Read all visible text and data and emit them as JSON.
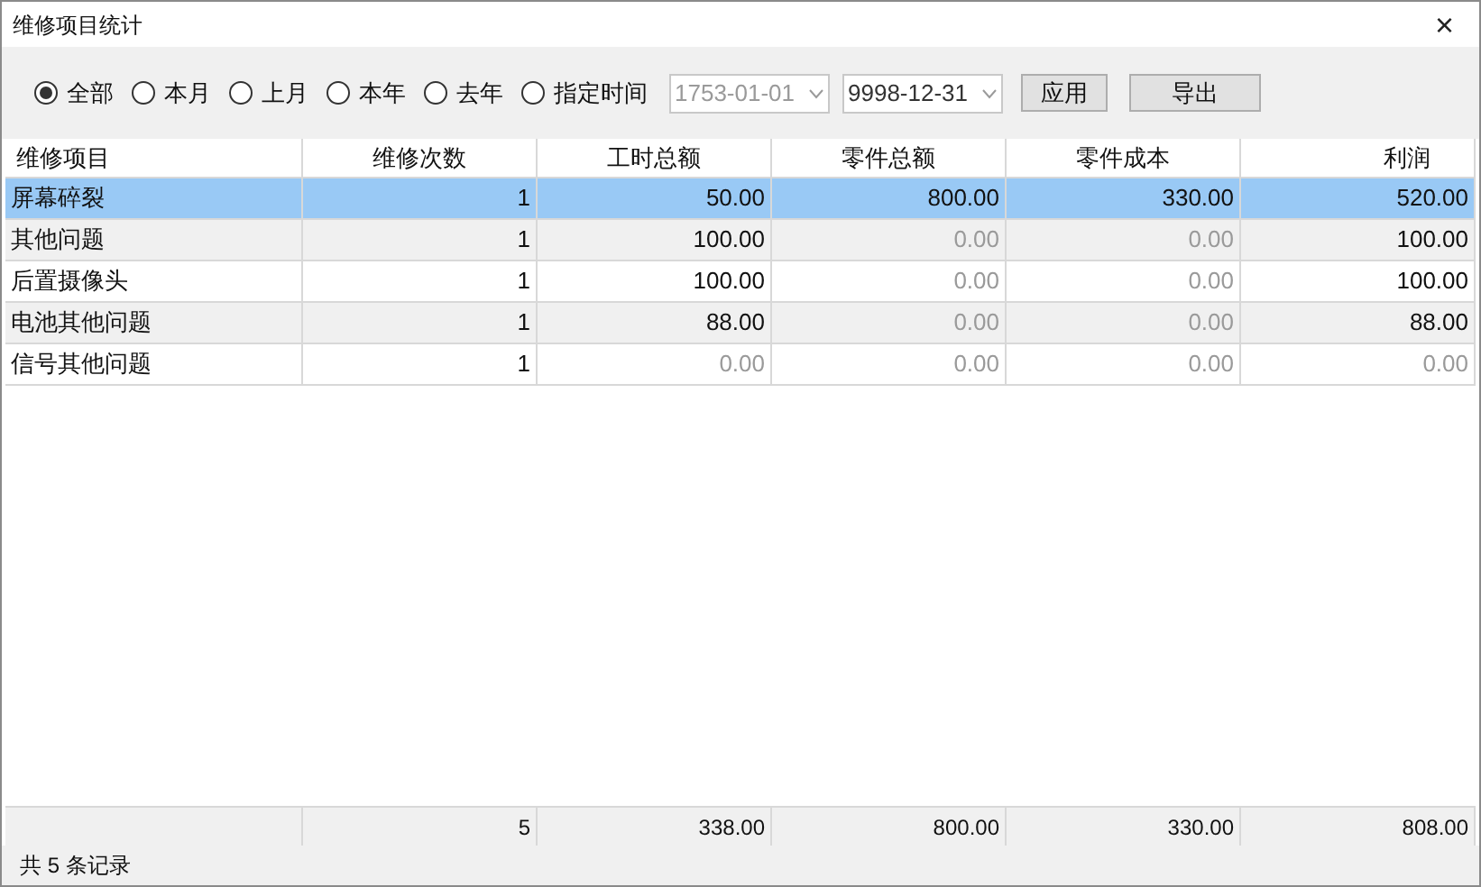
{
  "window": {
    "title": "维修项目统计",
    "close": "×"
  },
  "filters": [
    {
      "label": "全部",
      "selected": true
    },
    {
      "label": "本月",
      "selected": false
    },
    {
      "label": "上月",
      "selected": false
    },
    {
      "label": "本年",
      "selected": false
    },
    {
      "label": "去年",
      "selected": false
    },
    {
      "label": "指定时间",
      "selected": false
    }
  ],
  "date_from": {
    "value": "1753-01-01",
    "disabled": true
  },
  "date_to": {
    "value": "9998-12-31",
    "disabled": false
  },
  "buttons": [
    "应用",
    "导出"
  ],
  "table": {
    "columns": [
      "维修项目",
      "维修次数",
      "工时总额",
      "零件总额",
      "零件成本",
      "利润"
    ],
    "rows": [
      {
        "selected": true,
        "cells": [
          {
            "text": "屏幕碎裂",
            "dimmed": false
          },
          {
            "text": "1",
            "dimmed": false
          },
          {
            "text": "50.00",
            "dimmed": false
          },
          {
            "text": "800.00",
            "dimmed": false
          },
          {
            "text": "330.00",
            "dimmed": false
          },
          {
            "text": "520.00",
            "dimmed": false
          }
        ]
      },
      {
        "selected": false,
        "cells": [
          {
            "text": "其他问题",
            "dimmed": false
          },
          {
            "text": "1",
            "dimmed": false
          },
          {
            "text": "100.00",
            "dimmed": false
          },
          {
            "text": "0.00",
            "dimmed": true
          },
          {
            "text": "0.00",
            "dimmed": true
          },
          {
            "text": "100.00",
            "dimmed": false
          }
        ]
      },
      {
        "selected": false,
        "cells": [
          {
            "text": "后置摄像头",
            "dimmed": false
          },
          {
            "text": "1",
            "dimmed": false
          },
          {
            "text": "100.00",
            "dimmed": false
          },
          {
            "text": "0.00",
            "dimmed": true
          },
          {
            "text": "0.00",
            "dimmed": true
          },
          {
            "text": "100.00",
            "dimmed": false
          }
        ]
      },
      {
        "selected": false,
        "cells": [
          {
            "text": "电池其他问题",
            "dimmed": false
          },
          {
            "text": "1",
            "dimmed": false
          },
          {
            "text": "88.00",
            "dimmed": false
          },
          {
            "text": "0.00",
            "dimmed": true
          },
          {
            "text": "0.00",
            "dimmed": true
          },
          {
            "text": "88.00",
            "dimmed": false
          }
        ]
      },
      {
        "selected": false,
        "cells": [
          {
            "text": "信号其他问题",
            "dimmed": false
          },
          {
            "text": "1",
            "dimmed": false
          },
          {
            "text": "0.00",
            "dimmed": true
          },
          {
            "text": "0.00",
            "dimmed": true
          },
          {
            "text": "0.00",
            "dimmed": true
          },
          {
            "text": "0.00",
            "dimmed": true
          }
        ]
      }
    ],
    "totals": [
      "5",
      "338.00",
      "800.00",
      "330.00",
      "808.00"
    ]
  },
  "status_bar": "共 5 条记录"
}
